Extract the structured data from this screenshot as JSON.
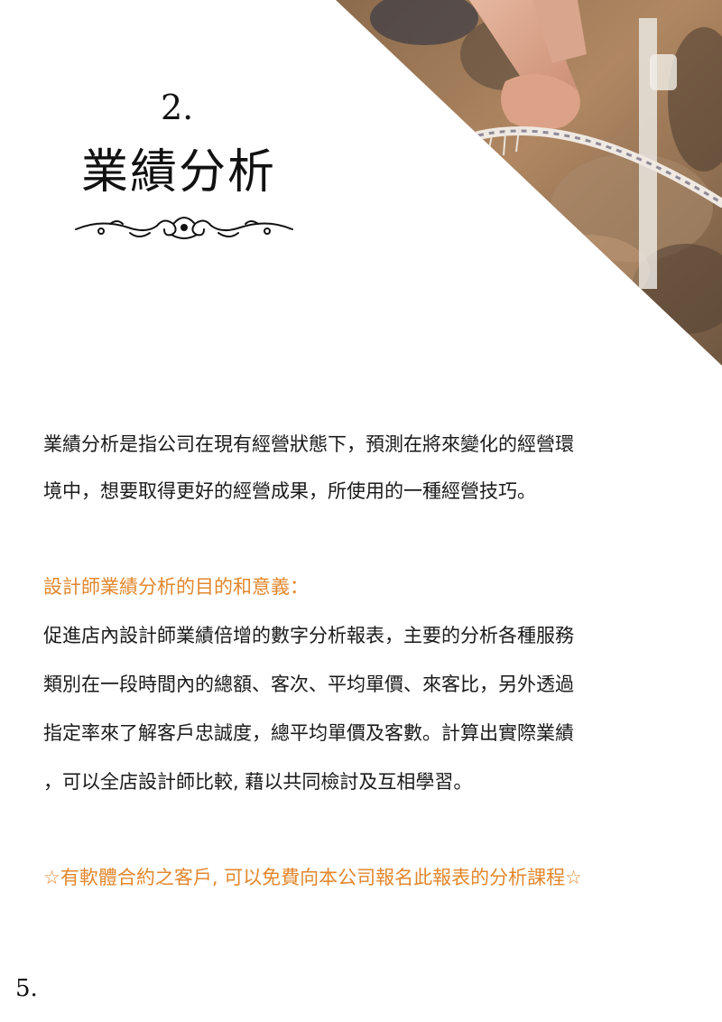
{
  "header": {
    "chapter_number": "2.",
    "chapter_title": "業績分析"
  },
  "intro": {
    "lines": [
      "業績分析是指公司在現有經營狀態下，預測在將來變化的經營環",
      "境中，想要取得更好的經營成果，所使用的一種經營技巧。"
    ]
  },
  "purpose": {
    "heading": "設計師業績分析的目的和意義：",
    "lines": [
      "促進店內設計師業績倍增的數字分析報表，主要的分析各種服務",
      "類別在一段時間內的總額、客次、平均單價、來客比，另外透過",
      "指定率來了解客戶忠誠度，總平均單價及客數。計算出實際業績",
      "，可以全店設計師比較, 藉以共同檢討及互相學習。"
    ]
  },
  "notice": {
    "text": "☆有軟體合約之客戶, 可以免費向本公司報名此報表的分析課程☆"
  },
  "footer": {
    "page_number": "5."
  },
  "colors": {
    "accent": "#e2872d",
    "text": "#1a1a1a"
  },
  "image": {
    "subject": "hand-pulling-rope-photo"
  }
}
